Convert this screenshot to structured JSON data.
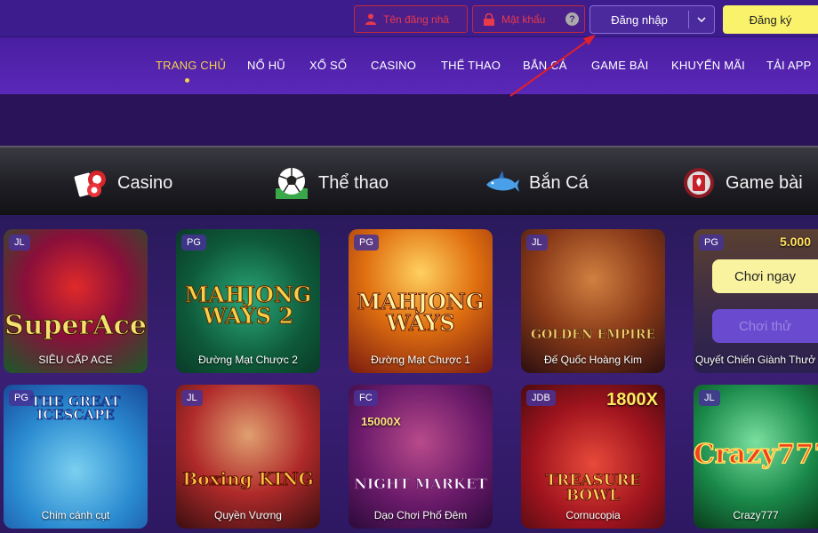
{
  "auth": {
    "username_placeholder": "Tên đăng nhâ",
    "password_placeholder": "Mật khẩu",
    "help_label": "?",
    "login_label": "Đăng nhập",
    "register_label": "Đăng ký"
  },
  "nav": {
    "items": [
      {
        "label": "TRANG CHỦ",
        "active": true
      },
      {
        "label": "NỔ HŨ"
      },
      {
        "label": "XỔ SỐ"
      },
      {
        "label": "CASINO"
      },
      {
        "label": "THỂ THAO"
      },
      {
        "label": "BẮN CÁ"
      },
      {
        "label": "GAME BÀI"
      },
      {
        "label": "KHUYẾN MÃI"
      },
      {
        "label": "TẢI APP"
      }
    ]
  },
  "categories": [
    {
      "label": "Casino",
      "icon": "casino-chips-icon"
    },
    {
      "label": "Thể thao",
      "icon": "soccer-ball-icon"
    },
    {
      "label": "Bắn Cá",
      "icon": "shark-icon"
    },
    {
      "label": "Game bài",
      "icon": "card-game-icon"
    }
  ],
  "games": [
    {
      "provider": "JL",
      "art": "SuperAce",
      "name": "SIÊU CẤP ACE"
    },
    {
      "provider": "PG",
      "art": "MAHJONG WAYS 2",
      "name": "Đường Mạt Chược 2"
    },
    {
      "provider": "PG",
      "art": "MAHJONG WAYS",
      "name": "Đường Mạt Chược 1"
    },
    {
      "provider": "JL",
      "art": "GOLDEN EMPIRE",
      "name": "Đế Quốc Hoàng Kim"
    },
    {
      "provider": "PG",
      "badge": "5.000",
      "name": "Quyết Chiến Giành Thưở"
    },
    {
      "provider": "PG",
      "art": "THE GREAT ICESCAPE",
      "name": "Chim cánh cụt"
    },
    {
      "provider": "JL",
      "art": "Boxing KING",
      "name": "Quyền Vương"
    },
    {
      "provider": "FC",
      "badge": "15000X",
      "art": "NIGHT MARKET",
      "name": "Dạo Chơi Phố Đêm"
    },
    {
      "provider": "JDB",
      "badge": "1800X",
      "art": "TREASURE BOWL",
      "name": "Cornucopia"
    },
    {
      "provider": "JL",
      "art": "Crazy777",
      "name": "Crazy777"
    }
  ],
  "overlay": {
    "play_now_label": "Chơi ngay",
    "try_label": "Chơi thử"
  },
  "colors": {
    "accent_yellow": "#f9f26a",
    "nav_active": "#f4d14a",
    "field_border": "#c0283a",
    "arrow": "#e0202a"
  }
}
